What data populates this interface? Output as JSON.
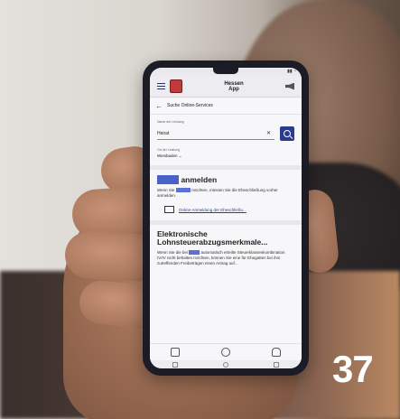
{
  "app": {
    "title_line1": "Hessen",
    "title_line2": "App"
  },
  "nav": {
    "back_label": "Suche Online-Services"
  },
  "search": {
    "label": "Name der Leistung",
    "value": "Heirat",
    "location_label": "Ort der Leistung",
    "location_value": "Wiesbaden"
  },
  "result1": {
    "title_highlight": "Heirat",
    "title_rest": " anmelden",
    "text_part1": "Wenn Sie ",
    "text_highlight": "heiraten",
    "text_part2": " möchten, müssen Sie die Eheschließung vorher anmelden.",
    "link": "Online-Anmeldung der Eheschließu..."
  },
  "result2": {
    "title": "Elektronische Lohnsteuerabzugsmerkmale...",
    "text_part1": "Wenn Sie die bei ",
    "text_highlight": "Heirat",
    "text_part2": " automatisch erteilte Steuerklassenkombination IV/IV nicht behalten möchten, können Sie eine für Ehegatten bei ihm zutreffenden Freibeträgen einen Antrag auf..."
  },
  "badge_number": "37"
}
